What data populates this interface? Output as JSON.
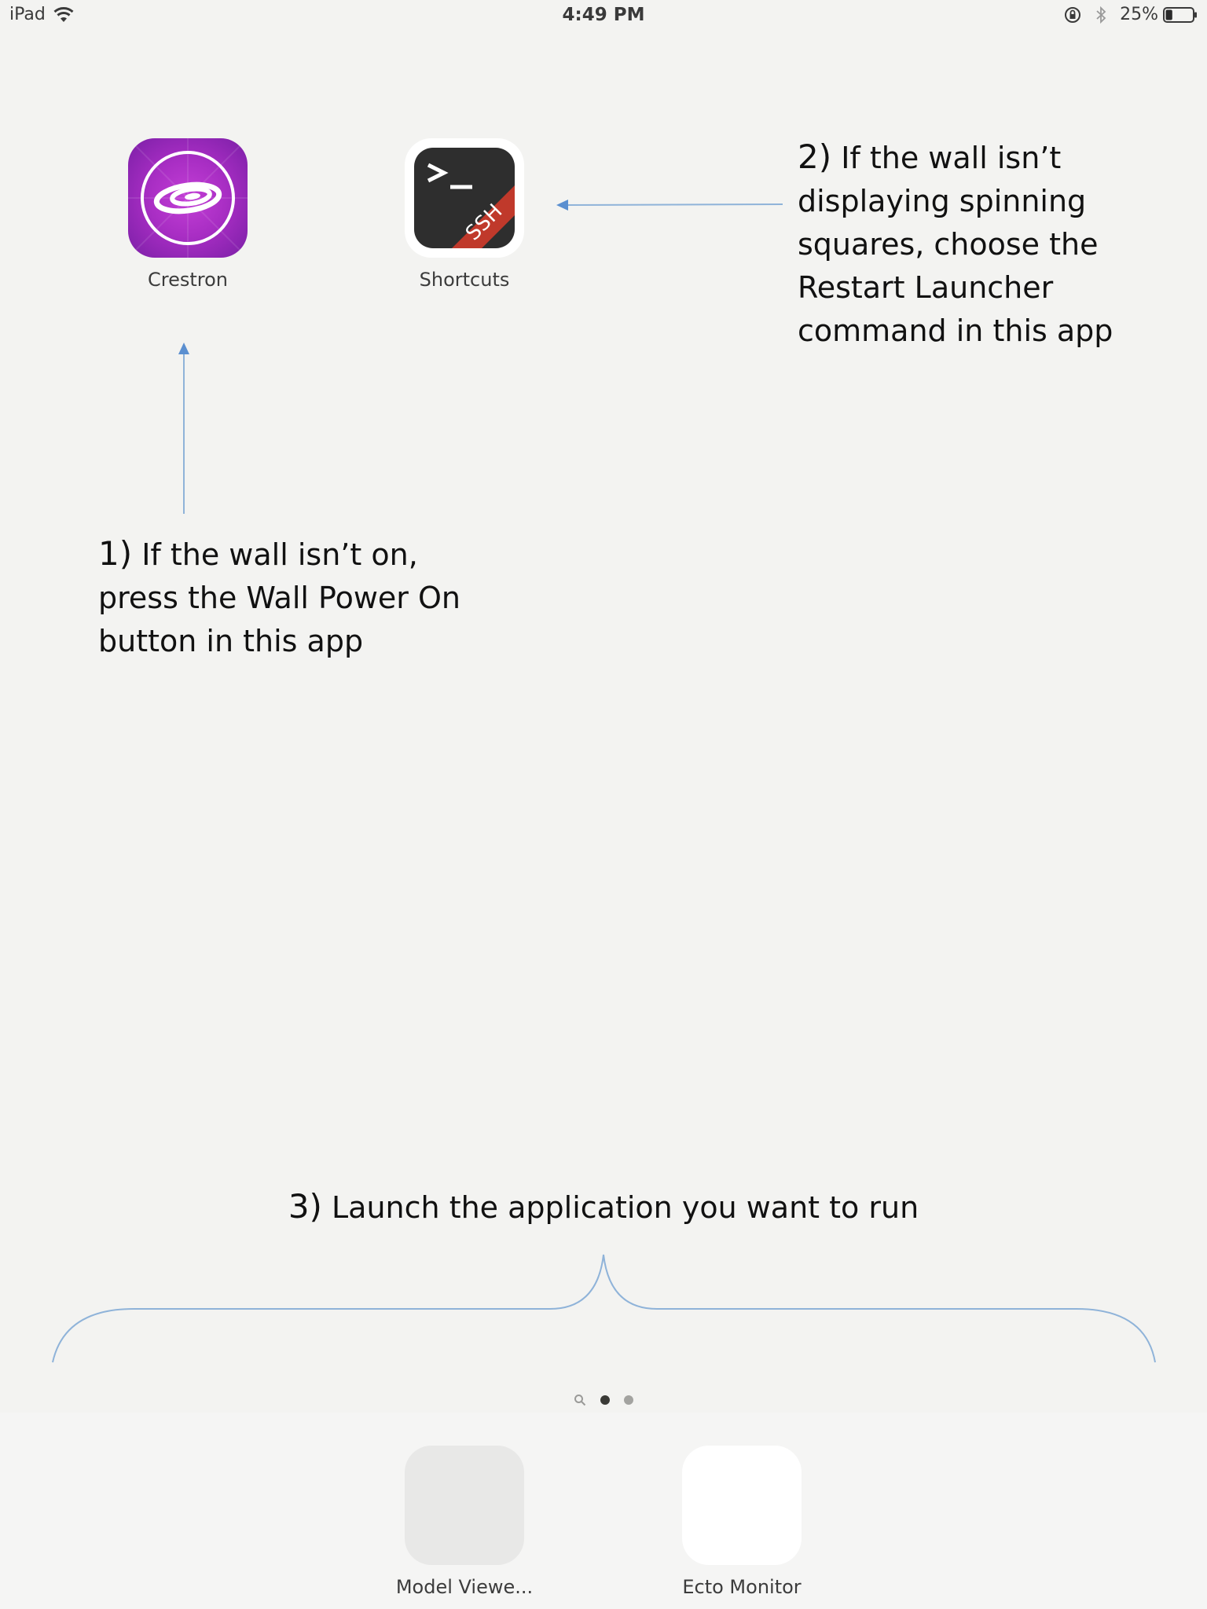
{
  "status_bar": {
    "device": "iPad",
    "time": "4:49 PM",
    "battery_percent": "25%",
    "battery_level": 0.25,
    "icons": [
      "wifi-icon",
      "orientation-lock-icon",
      "bluetooth-icon",
      "battery-icon"
    ]
  },
  "apps": [
    {
      "label": "Crestron",
      "icon": "crestron-app-icon"
    },
    {
      "label": "Shortcuts",
      "icon": "shortcuts-ssh-app-icon",
      "badge": "SSH"
    }
  ],
  "annotations": {
    "step1": {
      "number": "1)",
      "lines": [
        "If the wall isn’t on,",
        "press the Wall Power On",
        "button in this app"
      ]
    },
    "step2": {
      "number": "2)",
      "lines": [
        "If the wall isn’t",
        "displaying spinning",
        "squares, choose the",
        "Restart Launcher",
        "command in this app"
      ]
    },
    "step3": {
      "number": "3)",
      "text": "Launch the application you want to run"
    }
  },
  "page_indicator": {
    "pages": 3,
    "current": 2
  },
  "dock": {
    "apps": [
      {
        "label": "Model Viewe..."
      },
      {
        "label": "Ecto Monitor"
      }
    ]
  },
  "colors": {
    "background": "#f3f3f1",
    "annotation_line": "#8fb3d9",
    "arrow": "#5b8fd0",
    "crestron_purple": "#a92ec4",
    "ssh_ribbon": "#c0392b"
  }
}
